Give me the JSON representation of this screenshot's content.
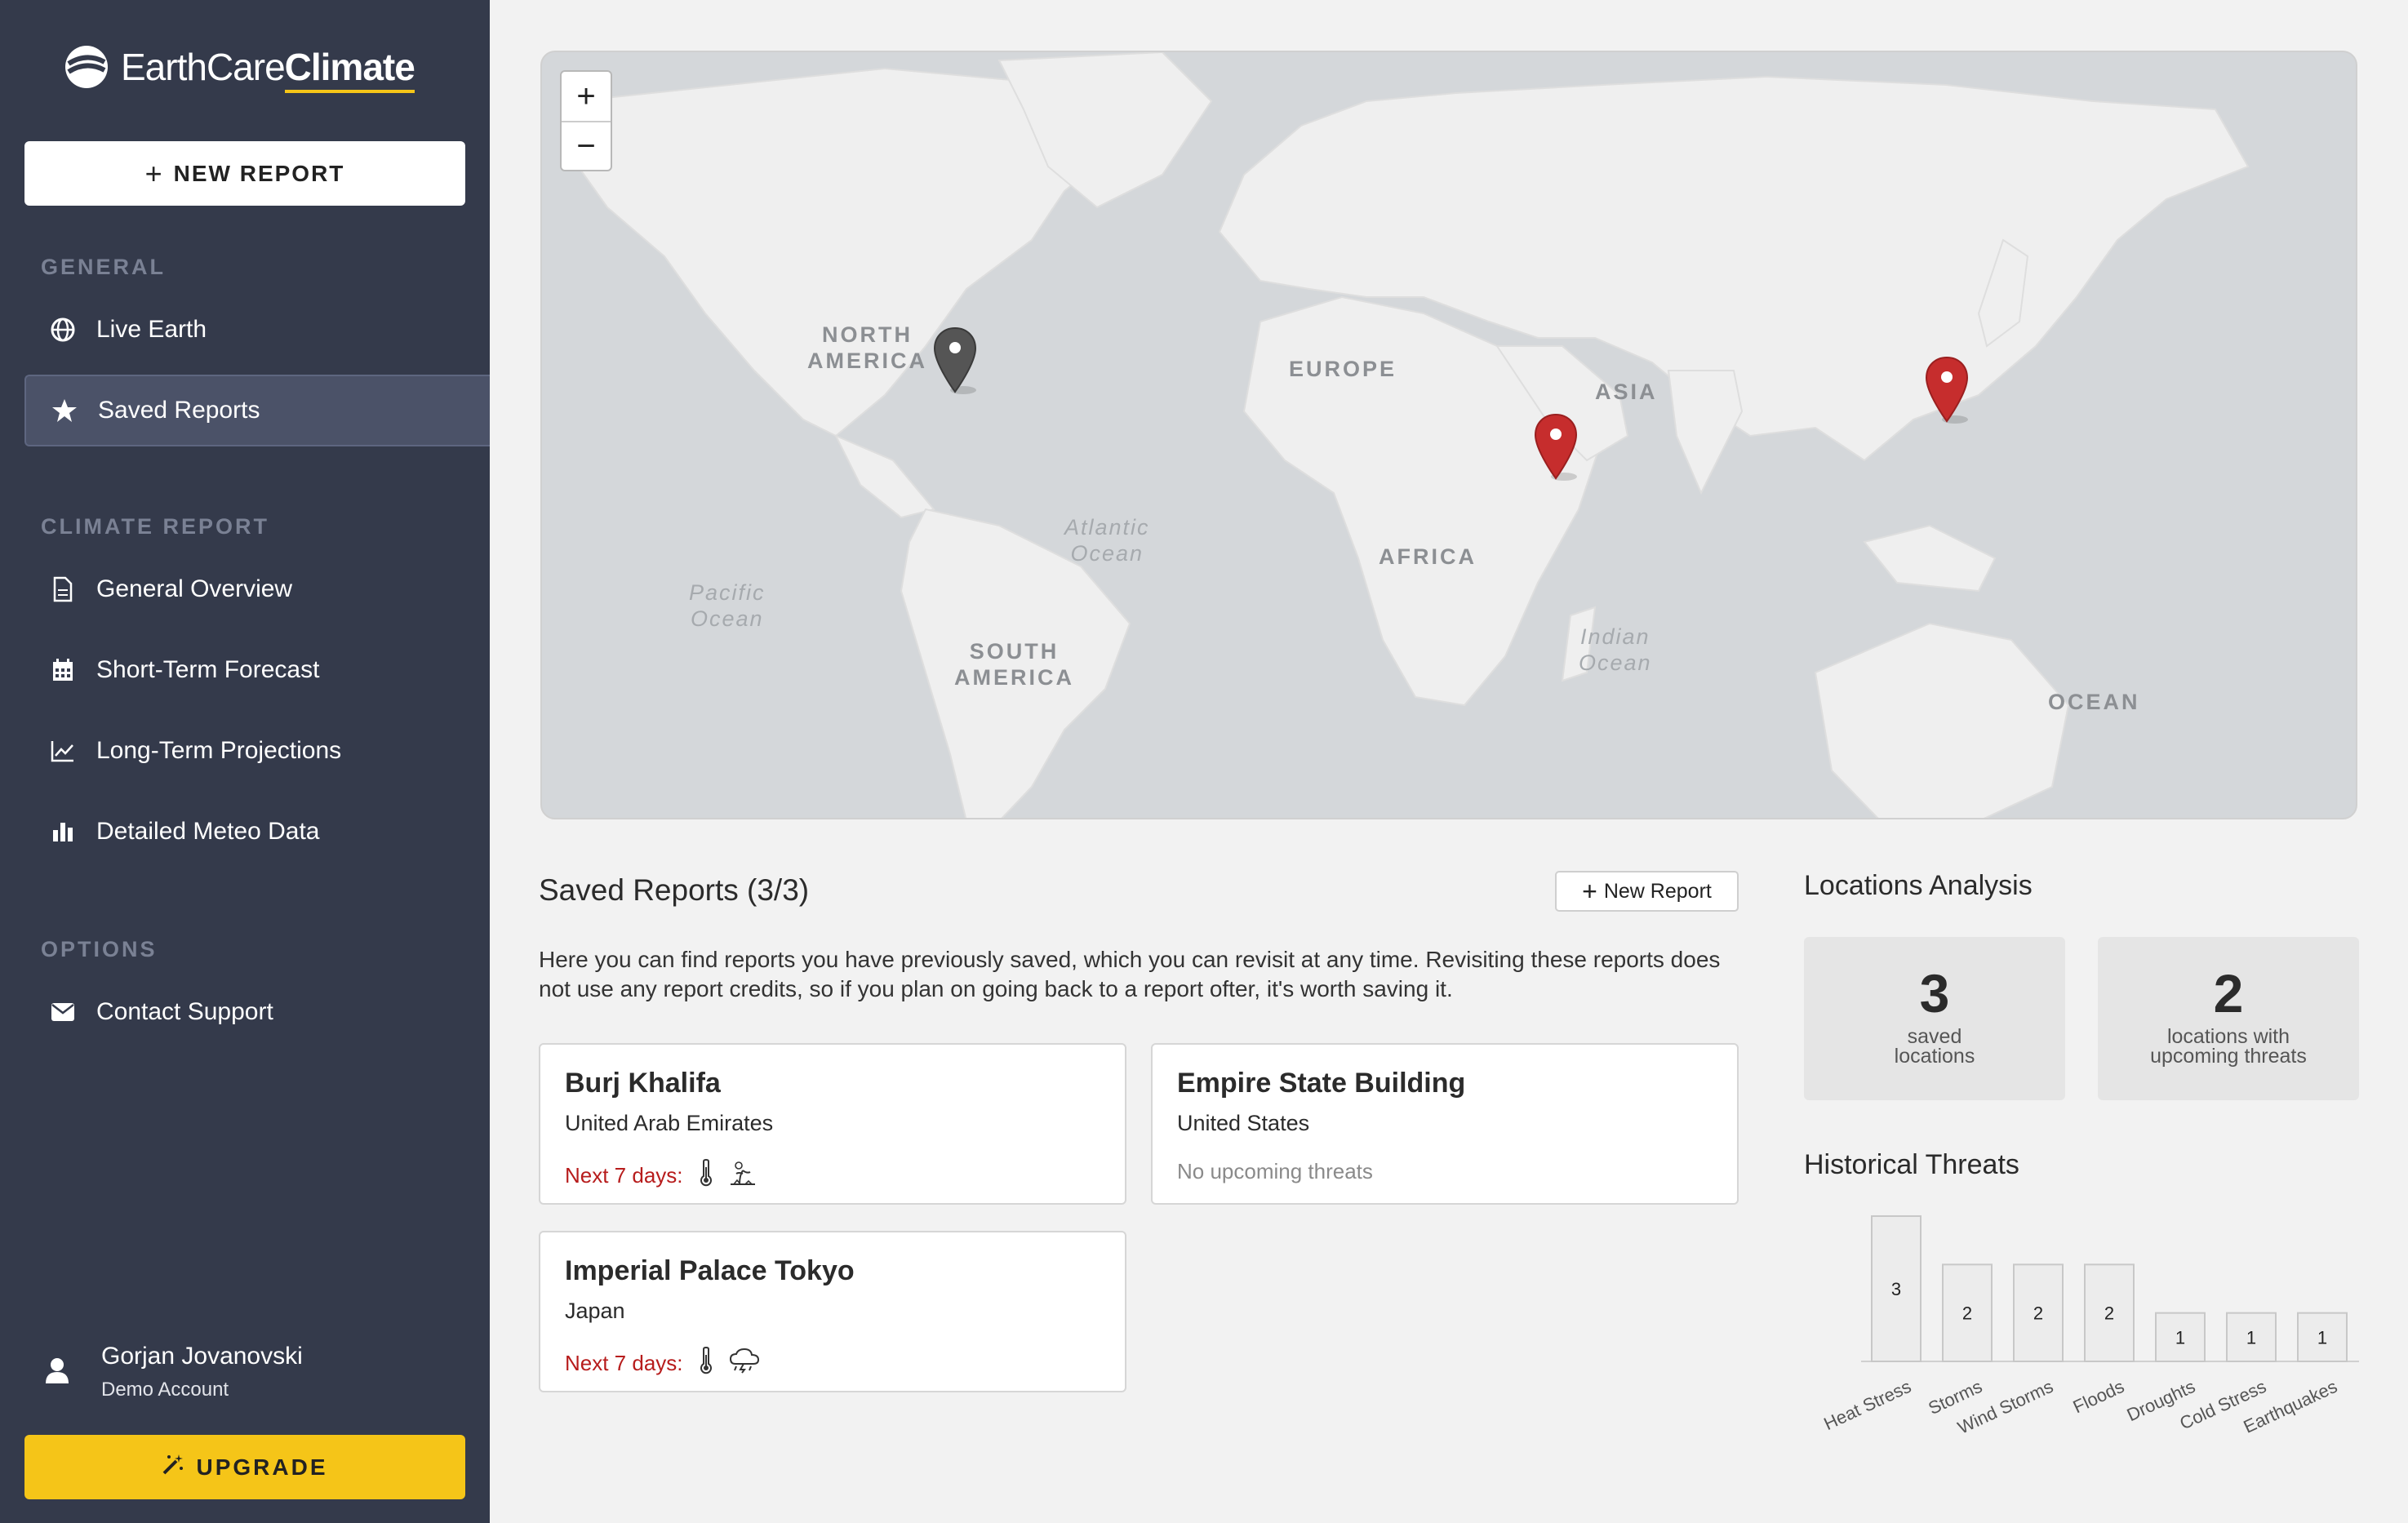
{
  "brand": {
    "name_light": "EarthCare",
    "name_bold": "Climate"
  },
  "sidebar": {
    "new_report": "NEW REPORT",
    "sections": {
      "general": "GENERAL",
      "climate_report": "CLIMATE REPORT",
      "options": "OPTIONS"
    },
    "items": {
      "live_earth": "Live Earth",
      "saved_reports": "Saved Reports",
      "general_overview": "General Overview",
      "short_term": "Short-Term Forecast",
      "long_term": "Long-Term Projections",
      "meteo": "Detailed Meteo Data",
      "contact": "Contact Support"
    },
    "user": {
      "name": "Gorjan Jovanovski",
      "role": "Demo Account"
    },
    "upgrade": "UPGRADE"
  },
  "map": {
    "zoom_in": "+",
    "zoom_out": "−",
    "labels": {
      "north_america_1": "NORTH",
      "north_america_2": "AMERICA",
      "europe": "EUROPE",
      "asia": "ASIA",
      "africa": "AFRICA",
      "south_america_1": "SOUTH",
      "south_america_2": "AMERICA",
      "oceania": "OCEAN",
      "atlantic_1": "Atlantic",
      "atlantic_2": "Ocean",
      "pacific_1": "Pacific",
      "pacific_2": "Ocean",
      "indian_1": "Indian",
      "indian_2": "Ocean"
    },
    "marker_colors": {
      "saved_no_threat": "#555555",
      "threat": "#c62d2d"
    }
  },
  "saved_reports": {
    "title": "Saved Reports (3/3)",
    "new_button": "New Report",
    "description": "Here you can find reports you have previously saved, which you can revisit at any time. Revisiting these reports does not use any report credits, so if you plan on going back to a report ofter, it's worth saving it.",
    "cards": [
      {
        "title": "Burj Khalifa",
        "country": "United Arab Emirates",
        "threat_label": "Next 7 days:",
        "icons": [
          "thermometer-icon",
          "drought-icon"
        ]
      },
      {
        "title": "Empire State Building",
        "country": "United States",
        "threat_label": "No upcoming threats",
        "icons": []
      },
      {
        "title": "Imperial Palace Tokyo",
        "country": "Japan",
        "threat_label": "Next 7 days:",
        "icons": [
          "thermometer-icon",
          "storm-icon"
        ]
      }
    ]
  },
  "analysis": {
    "title": "Locations Analysis",
    "stats": [
      {
        "value": "3",
        "label_1": "saved",
        "label_2": "locations"
      },
      {
        "value": "2",
        "label_1": "locations with",
        "label_2": "upcoming threats"
      }
    ]
  },
  "historical": {
    "title": "Historical Threats",
    "chart_data": {
      "type": "bar",
      "categories": [
        "Heat Stress",
        "Storms",
        "Wind Storms",
        "Floods",
        "Droughts",
        "Cold Stress",
        "Earthquakes"
      ],
      "values": [
        3,
        2,
        2,
        2,
        1,
        1,
        1
      ],
      "ylim": [
        0,
        3
      ],
      "grid": false,
      "data_labels": true
    }
  }
}
